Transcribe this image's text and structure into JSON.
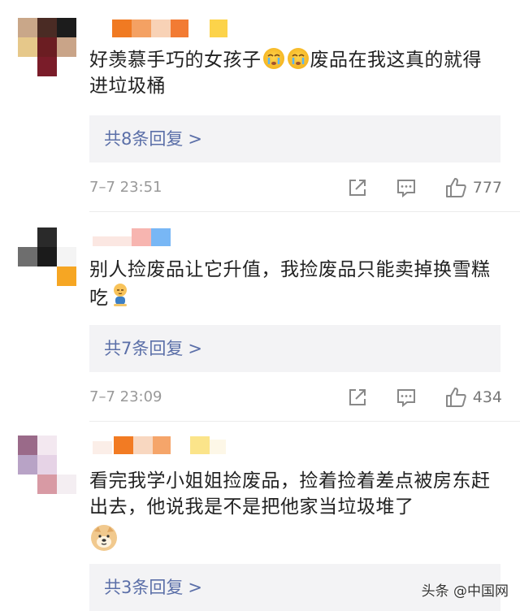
{
  "comments": [
    {
      "text_a": "好羡慕手巧的女孩子",
      "emoji_a": "crying-emoji",
      "text_b": "废品在我这真的就得进垃圾桶",
      "replies": "共8条回复",
      "reply_arrow": ">",
      "time": "7–7 23:51",
      "likes": "777"
    },
    {
      "text_a": "别人捡废品让它升值，我捡废品只能卖掉换雪糕吃",
      "emoji_a": "pensive-kid-emoji",
      "replies": "共7条回复",
      "reply_arrow": ">",
      "time": "7–7 23:09",
      "likes": "434"
    },
    {
      "text_a": "看完我学小姐姐捡废品，捡着捡着差点被房东赶出去，他说我是不是把他家当垃圾堆了",
      "emoji_a": "doge-emoji",
      "replies": "共3条回复",
      "reply_arrow": ">"
    }
  ],
  "watermark": "头条 @中国网",
  "colors": {
    "link": "#5b6fa8",
    "reply_bg": "#f3f3f5",
    "meta": "#999999"
  }
}
